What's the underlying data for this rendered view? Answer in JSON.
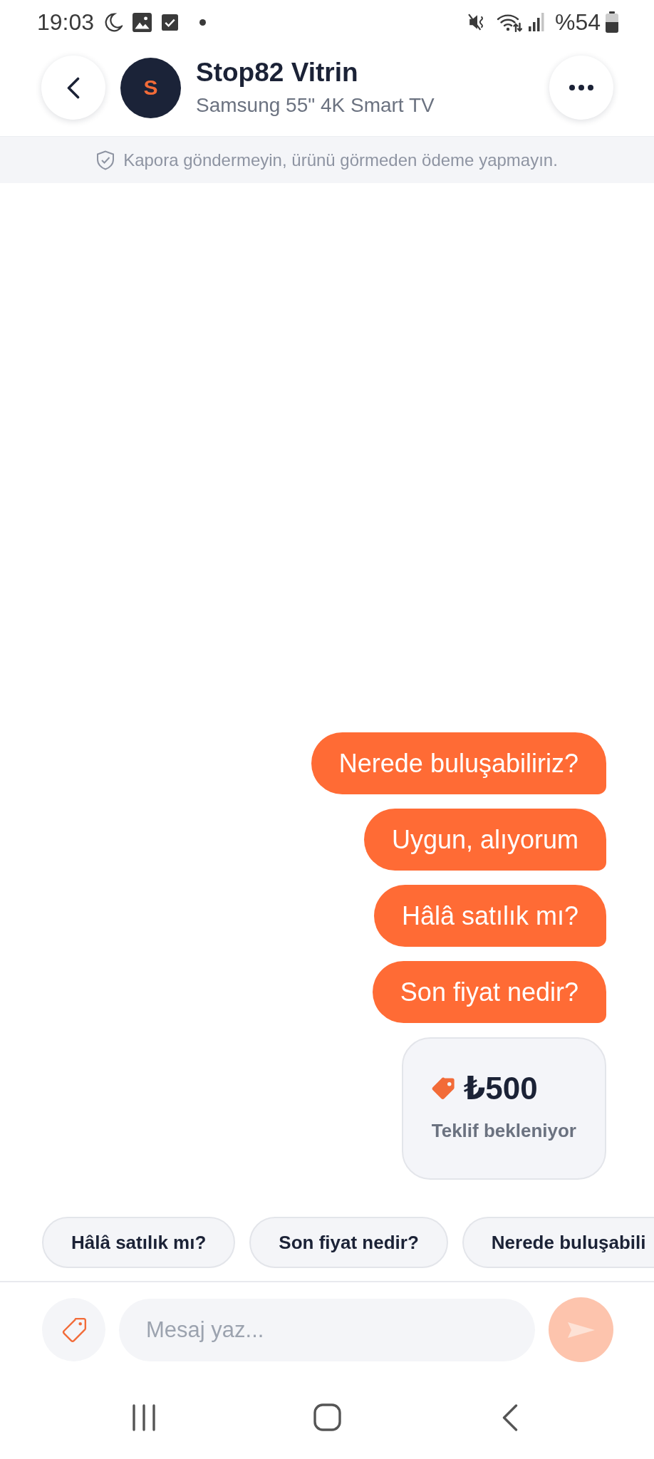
{
  "status_bar": {
    "time": "19:03",
    "battery": "%54"
  },
  "header": {
    "avatar_letter": "S",
    "title": "Stop82 Vitrin",
    "subtitle": "Samsung 55\" 4K Smart TV"
  },
  "safety_notice": "Kapora göndermeyin, ürünü görmeden ödeme yapmayın.",
  "messages": [
    {
      "kind": "text",
      "text": "Nerede buluşabiliriz?"
    },
    {
      "kind": "text",
      "text": "Uygun, alıyorum"
    },
    {
      "kind": "text",
      "text": "Hâlâ satılık mı?"
    },
    {
      "kind": "text",
      "text": "Son fiyat nedir?"
    },
    {
      "kind": "offer",
      "amount": "₺500",
      "status": "Teklif bekleniyor"
    }
  ],
  "quick_replies": [
    "Hâlâ satılık mı?",
    "Son fiyat nedir?",
    "Nerede buluşabili"
  ],
  "composer": {
    "placeholder": "Mesaj yaz...",
    "send_disabled": true
  }
}
